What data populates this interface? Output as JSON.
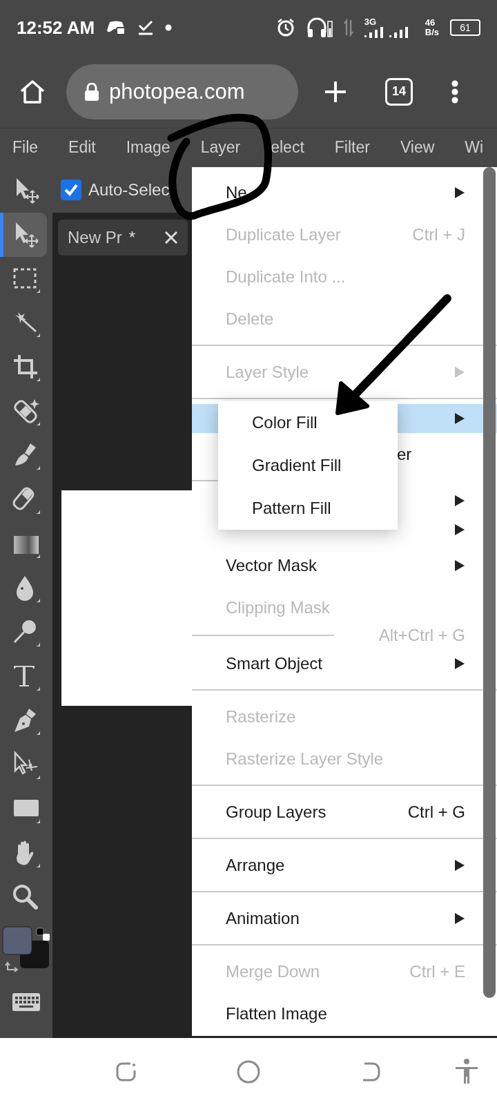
{
  "status_bar": {
    "time": "12:52 AM",
    "network": "3G",
    "speed": "46",
    "speed_unit": "B/s",
    "battery": "61"
  },
  "browser": {
    "url": "photopea.com",
    "tab_count": "14"
  },
  "menubar": [
    {
      "label": "File"
    },
    {
      "label": "Edit"
    },
    {
      "label": "Image"
    },
    {
      "label": "Layer"
    },
    {
      "label": "elect"
    },
    {
      "label": "Filter"
    },
    {
      "label": "View"
    },
    {
      "label": "Wi"
    }
  ],
  "tools": [
    {
      "kind": "move",
      "selected": false
    },
    {
      "kind": "move",
      "selected": true
    },
    {
      "kind": "marquee",
      "selected": false
    },
    {
      "kind": "wand",
      "selected": false
    },
    {
      "kind": "crop",
      "selected": false
    },
    {
      "kind": "heal",
      "selected": false
    },
    {
      "kind": "brush",
      "selected": false
    },
    {
      "kind": "eraser",
      "selected": false
    },
    {
      "kind": "gradient",
      "selected": false
    },
    {
      "kind": "blur",
      "selected": false
    },
    {
      "kind": "dodge",
      "selected": false
    },
    {
      "kind": "type",
      "selected": false
    },
    {
      "kind": "pen",
      "selected": false
    },
    {
      "kind": "path_select",
      "selected": false
    },
    {
      "kind": "rectangle",
      "selected": false
    },
    {
      "kind": "hand",
      "selected": false
    },
    {
      "kind": "zoom",
      "selected": false
    }
  ],
  "options": {
    "auto_select": {
      "label": "Auto-Selec",
      "checked": true
    }
  },
  "document_tab": {
    "title": "New Pr",
    "modified": "*"
  },
  "layer_menu": [
    {
      "kind": "item",
      "label": "Ne",
      "submenu": true,
      "disabled": false,
      "selected": false
    },
    {
      "kind": "item",
      "label": "Duplicate Layer",
      "shortcut": "Ctrl + J",
      "disabled": true,
      "selected": false
    },
    {
      "kind": "item",
      "label": "Duplicate Into ...",
      "disabled": true,
      "selected": false
    },
    {
      "kind": "item",
      "label": "Delete",
      "disabled": true,
      "selected": false
    },
    {
      "kind": "divider"
    },
    {
      "kind": "item",
      "label": "Layer Style",
      "submenu": true,
      "disabled": true,
      "selected": false
    },
    {
      "kind": "divider"
    },
    {
      "kind": "stub",
      "submenu": true,
      "selected": true
    },
    {
      "kind": "tail",
      "label": "er",
      "selected": false
    },
    {
      "kind": "divider",
      "partial": true
    },
    {
      "kind": "stub",
      "submenu": true,
      "selected": false
    },
    {
      "kind": "stub",
      "submenu": true,
      "selected": false
    },
    {
      "kind": "item",
      "label": "Vector Mask",
      "submenu": true,
      "disabled": false,
      "selected": false
    },
    {
      "kind": "item",
      "label": "Clipping Mask",
      "disabled": true,
      "selected": false
    },
    {
      "kind": "divider",
      "partial": true,
      "shortcut": "Alt+Ctrl + G"
    },
    {
      "kind": "item",
      "label": "Smart Object",
      "submenu": true,
      "disabled": false,
      "selected": false
    },
    {
      "kind": "divider"
    },
    {
      "kind": "item",
      "label": "Rasterize",
      "disabled": true,
      "selected": false
    },
    {
      "kind": "item",
      "label": "Rasterize Layer Style",
      "disabled": true,
      "selected": false
    },
    {
      "kind": "divider"
    },
    {
      "kind": "item",
      "label": "Group Layers",
      "shortcut": "Ctrl + G",
      "disabled": false,
      "selected": false
    },
    {
      "kind": "divider"
    },
    {
      "kind": "item",
      "label": "Arrange",
      "submenu": true,
      "disabled": false,
      "selected": false
    },
    {
      "kind": "divider"
    },
    {
      "kind": "item",
      "label": "Animation",
      "submenu": true,
      "disabled": false,
      "selected": false
    },
    {
      "kind": "divider"
    },
    {
      "kind": "item",
      "label": "Merge Down",
      "shortcut": "Ctrl + E",
      "disabled": true,
      "selected": false
    },
    {
      "kind": "item",
      "label": "Flatten Image",
      "disabled": false,
      "selected": false
    }
  ],
  "fill_submenu": [
    {
      "label": "Color Fill"
    },
    {
      "label": "Gradient Fill"
    },
    {
      "label": "Pattern Fill"
    }
  ]
}
